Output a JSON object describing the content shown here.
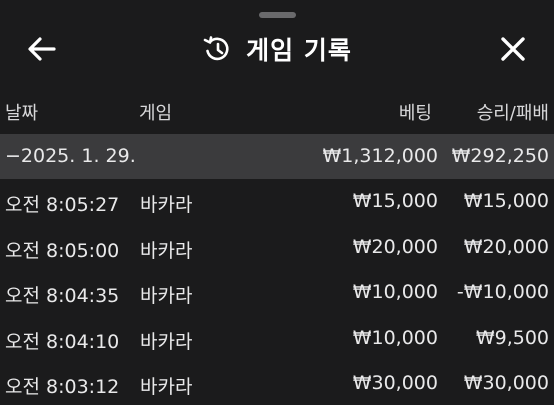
{
  "header": {
    "title": "게임 기록",
    "back_icon": "arrow-left-icon",
    "history_icon": "history-icon",
    "close_icon": "close-icon"
  },
  "columns": {
    "date": "날짜",
    "game": "게임",
    "bet": "베팅",
    "result": "승리/패배"
  },
  "group": {
    "date": "−2025. 1. 29.",
    "bet_total": "₩1,312,000",
    "result_total": "₩292,250"
  },
  "rows": [
    {
      "time": "오전 8:05:27",
      "game": "바카라",
      "bet": "₩15,000",
      "result": "₩15,000"
    },
    {
      "time": "오전 8:05:00",
      "game": "바카라",
      "bet": "₩20,000",
      "result": "₩20,000"
    },
    {
      "time": "오전 8:04:35",
      "game": "바카라",
      "bet": "₩10,000",
      "result": "-₩10,000"
    },
    {
      "time": "오전 8:04:10",
      "game": "바카라",
      "bet": "₩10,000",
      "result": "₩9,500"
    },
    {
      "time": "오전 8:03:12",
      "game": "바카라",
      "bet": "₩30,000",
      "result": "₩30,000"
    }
  ]
}
